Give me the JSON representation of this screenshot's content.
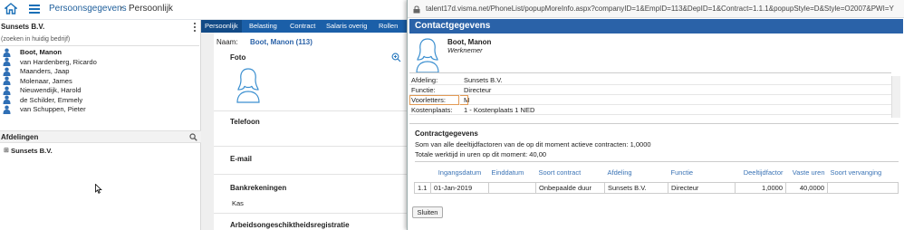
{
  "header": {
    "breadcrumb_1": "Persoonsgegevens",
    "breadcrumb_sep": "›",
    "breadcrumb_2": "Persoonlijk"
  },
  "left": {
    "company": "Sunsets B.V.",
    "search_placeholder": "(zoeken in huidig bedrijf)",
    "employees": [
      "Boot, Manon",
      "van Hardenberg, Ricardo",
      "Maanders, Jaap",
      "Molenaar, James",
      "Nieuwendijk, Harold",
      "de Schilder, Emmely",
      "van Schuppen, Pieter"
    ],
    "departments_title": "Afdelingen",
    "tree_toggle": "⊞",
    "tree_root": "Sunsets B.V."
  },
  "tabs": [
    "Persoonlijk",
    "Belasting",
    "Contract",
    "Salaris overig",
    "Rollen"
  ],
  "middle": {
    "name_label": "Naam:",
    "name_value": "Boot, Manon (113)",
    "foto": "Foto",
    "telefoon": "Telefoon",
    "email": "E-mail",
    "bank": "Bankrekeningen",
    "bank_value": "Kas",
    "arbeid": "Arbeidsongeschiktheidsregistratie"
  },
  "modal": {
    "url": "talent17d.visma.net/PhoneList/popupMoreInfo.aspx?companyID=1&EmpID=113&DepID=1&Contract=1.1.1&popupStyle=D&Style=O2007&PWI=Y",
    "title": "Contactgegevens",
    "person_name": "Boot, Manon",
    "person_role": "Werknemer",
    "fields": [
      {
        "k": "Afdeling:",
        "v": "Sunsets B.V."
      },
      {
        "k": "Functie:",
        "v": "Directeur"
      },
      {
        "k": "Voorletters:",
        "v": "M"
      },
      {
        "k": "Kostenplaats:",
        "v": "1 - Kostenplaats 1 NED"
      }
    ],
    "contract_title": "Contractgegevens",
    "contract_line1": "Som van alle deeltijdfactoren van de op dit moment actieve contracten: 1,0000",
    "contract_line2": "Totale werktijd in uren op dit moment: 40,00",
    "table_headers": [
      "",
      "Ingangsdatum",
      "Einddatum",
      "Soort contract",
      "Afdeling",
      "Functie",
      "Deeltijdfactor",
      "Vaste uren",
      "Soort vervanging"
    ],
    "table_row": [
      "1.1",
      "01-Jan-2019",
      "",
      "Onbepaalde duur",
      "Sunsets B.V.",
      "Directeur",
      "1,0000",
      "40,0000",
      ""
    ],
    "close_button": "Sluiten"
  },
  "colors": {
    "accent": "#1b5fa8",
    "modal_title": "#2a62a8",
    "highlight": "#e39a54"
  }
}
